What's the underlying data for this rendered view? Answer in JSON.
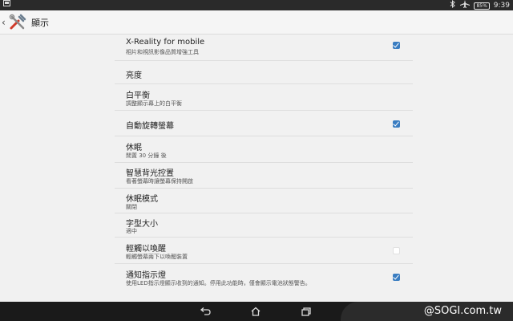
{
  "status_bar": {
    "battery": "85%",
    "time": "9:39",
    "icons": [
      "notification-icon",
      "bluetooth-icon",
      "airplane-icon",
      "battery-icon"
    ]
  },
  "action_bar": {
    "title": "顯示",
    "icon": "display-settings-icon"
  },
  "settings": [
    {
      "title": "X-Reality for mobile",
      "subtitle": "相片和視訊影像品質增強工具",
      "checkbox": "checked"
    },
    {
      "title": "亮度",
      "subtitle": "",
      "checkbox": "none"
    },
    {
      "title": "白平衡",
      "subtitle": "調整顯示幕上的白平衡",
      "checkbox": "none"
    },
    {
      "title": "自動旋轉螢幕",
      "subtitle": "",
      "checkbox": "checked"
    },
    {
      "title": "休眠",
      "subtitle": "閒置 30 分鐘 後",
      "checkbox": "none"
    },
    {
      "title": "智慧背光控置",
      "subtitle": "看著螢幕時讓螢幕保持開啟",
      "checkbox": "none"
    },
    {
      "title": "休眠模式",
      "subtitle": "關閉",
      "checkbox": "none"
    },
    {
      "title": "字型大小",
      "subtitle": "適中",
      "checkbox": "none"
    },
    {
      "title": "輕觸以喚醒",
      "subtitle": "輕觸螢幕兩下以喚醒裝置",
      "checkbox": "unchecked"
    },
    {
      "title": "通知指示燈",
      "subtitle": "使用LED指示燈顯示收到的通知。停用此功能時，僅會顯示電池狀態警告。",
      "checkbox": "checked"
    }
  ],
  "nav_bar": {
    "buttons": [
      "back-icon",
      "home-icon",
      "recent-apps-icon"
    ]
  },
  "watermark": "@SOGI.com.tw",
  "colors": {
    "accent": "#3a7dc1",
    "status_bar": "#2a2a2a",
    "nav_bar": "#1a1a1a",
    "background": "#f1f1f1"
  }
}
